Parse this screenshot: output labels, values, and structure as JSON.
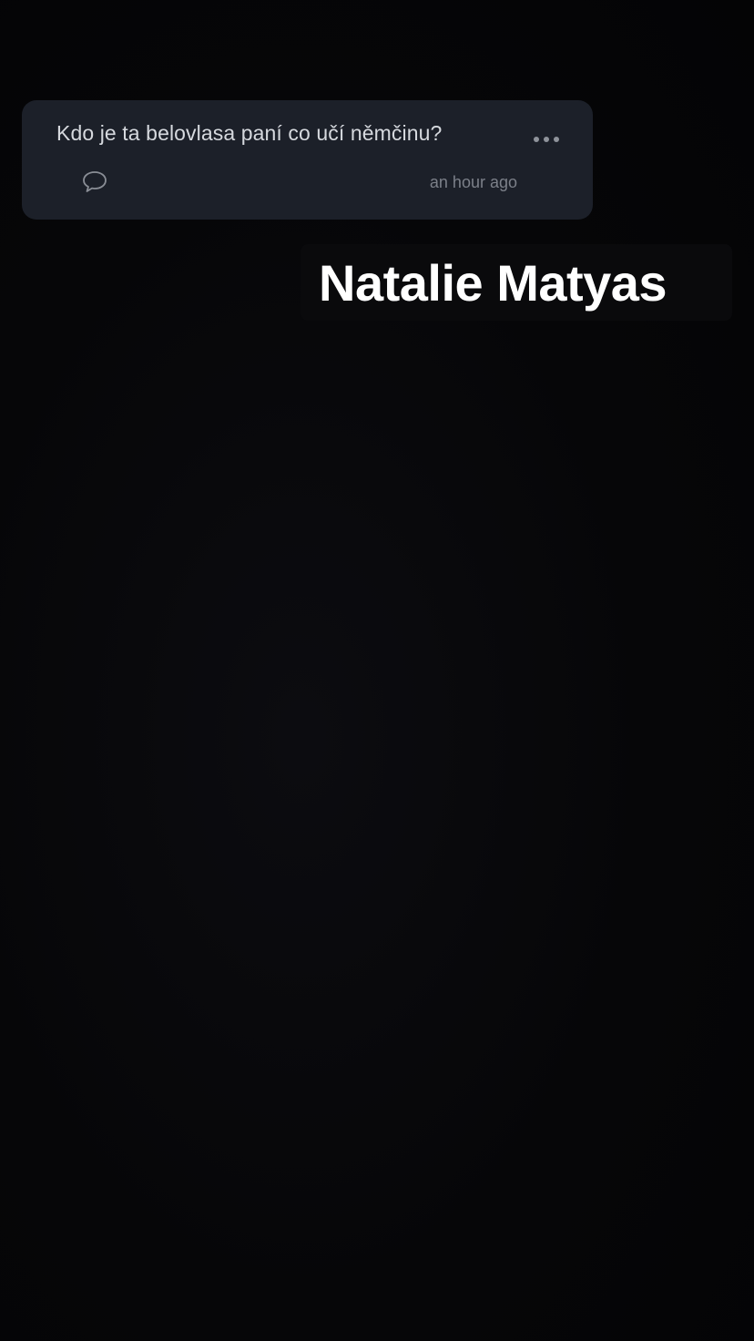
{
  "question_card": {
    "question": "Kdo je ta belovlasa paní co učí němčinu?",
    "timestamp": "an hour ago",
    "more_icon": "more-horizontal-icon",
    "comment_icon": "comment-bubble-icon"
  },
  "name_sticker": {
    "text": "Natalie Matyas"
  },
  "colors": {
    "background": "#050507",
    "card_background": "#1c2029",
    "question_text": "#d6d9de",
    "muted_text": "#7c8089",
    "sticker_text": "#ffffff"
  }
}
